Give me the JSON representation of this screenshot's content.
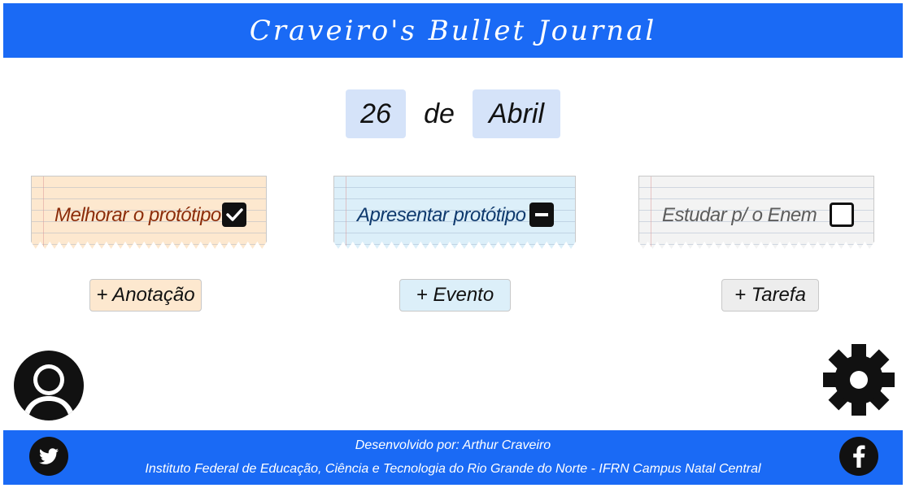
{
  "header": {
    "title": "Craveiro's Bullet Journal"
  },
  "date": {
    "day": "26",
    "separator": "de",
    "month": "Abril"
  },
  "notes": [
    {
      "text": "Melhorar o protótipo",
      "status": "checked"
    },
    {
      "text": "Apresentar protótipo",
      "status": "in-progress"
    },
    {
      "text": "Estudar p/ o Enem",
      "status": "unchecked"
    }
  ],
  "buttons": {
    "add_anotacao": "+ Anotação",
    "add_evento": "+ Evento",
    "add_tarefa": "+ Tarefa"
  },
  "footer": {
    "line1": "Desenvolvido por:  Arthur Craveiro",
    "line2": "Instituto Federal de Educação, Ciência e Tecnologia do Rio Grande do Norte - IFRN Campus Natal Central"
  },
  "icons": {
    "profile": "user-icon",
    "settings": "gear-icon",
    "twitter": "twitter-icon",
    "facebook": "facebook-icon"
  },
  "colors": {
    "brand_blue": "#1a6af5",
    "anotacao_bg": "#fde8cf",
    "evento_bg": "#dceff9",
    "tarefa_bg": "#ededed",
    "date_bg": "#d5e3f9"
  }
}
